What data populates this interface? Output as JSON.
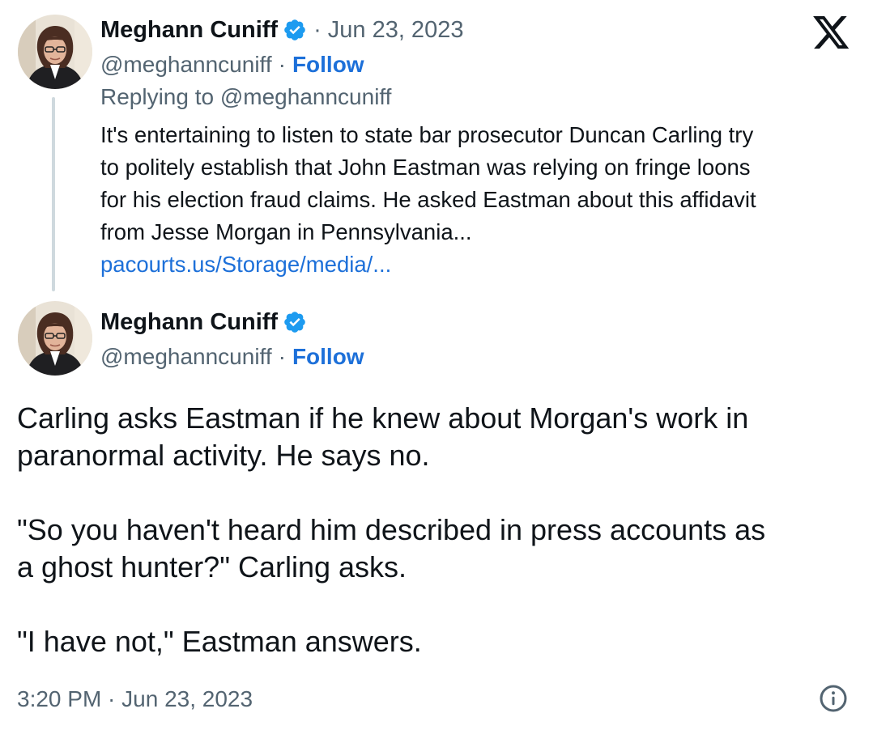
{
  "parent_tweet": {
    "author_name": "Meghann Cuniff",
    "separator": "·",
    "date": "Jun 23, 2023",
    "handle": "@meghanncuniff",
    "handle_separator": "·",
    "follow_label": "Follow",
    "replying_to": "Replying to @meghanncuniff",
    "text_lines": [
      "It's entertaining to listen to state bar prosecutor Duncan Carling try",
      "to politely establish that John Eastman was relying on fringe loons",
      "for his election fraud claims. He asked Eastman about this affidavit",
      "from Jesse Morgan in Pennsylvania..."
    ],
    "link_text": "pacourts.us/Storage/media/..."
  },
  "main_tweet": {
    "author_name": "Meghann Cuniff",
    "handle": "@meghanncuniff",
    "handle_separator": "·",
    "follow_label": "Follow",
    "text_lines": [
      "Carling asks Eastman if he knew about Morgan's work in",
      "paranormal activity. He says no.",
      "",
      "\"So you haven't heard him described in press accounts as",
      "a ghost hunter?\" Carling asks.",
      "",
      "\"I have not,\" Eastman answers."
    ],
    "timestamp": "3:20 PM · Jun 23, 2023"
  },
  "icons": {
    "platform_logo": "x-logo-icon",
    "verified": "verified-badge-icon",
    "info": "info-icon"
  },
  "colors": {
    "text": "#0f1419",
    "secondary": "#536471",
    "link": "#1d70d9",
    "verified_badge": "#1d9bf0",
    "thread_line": "#cfd9de"
  }
}
